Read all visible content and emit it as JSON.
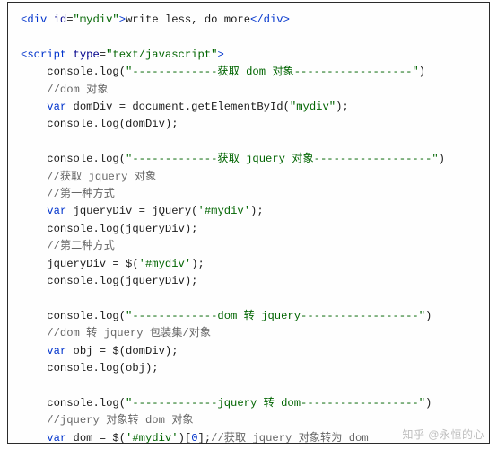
{
  "code": {
    "lines": [
      {
        "indent": 0,
        "spans": [
          {
            "t": "<div ",
            "c": "blue"
          },
          {
            "t": "id",
            "c": "dblue"
          },
          {
            "t": "=",
            "c": "black"
          },
          {
            "t": "\"mydiv\"",
            "c": "green"
          },
          {
            "t": ">",
            "c": "blue"
          },
          {
            "t": "write less, do more",
            "c": "black"
          },
          {
            "t": "</div>",
            "c": "blue"
          }
        ]
      },
      {
        "indent": 0,
        "spans": [
          {
            "t": " ",
            "c": "black"
          }
        ]
      },
      {
        "indent": 0,
        "spans": [
          {
            "t": "<script ",
            "c": "blue"
          },
          {
            "t": "type",
            "c": "dblue"
          },
          {
            "t": "=",
            "c": "black"
          },
          {
            "t": "\"text/javascript\"",
            "c": "green"
          },
          {
            "t": ">",
            "c": "blue"
          }
        ]
      },
      {
        "indent": 1,
        "spans": [
          {
            "t": "console.log(",
            "c": "black"
          },
          {
            "t": "\"-------------获取 dom 对象------------------\"",
            "c": "green"
          },
          {
            "t": ")",
            "c": "black"
          }
        ]
      },
      {
        "indent": 1,
        "spans": [
          {
            "t": "//dom 对象",
            "c": "gray"
          }
        ]
      },
      {
        "indent": 1,
        "spans": [
          {
            "t": "var ",
            "c": "blue"
          },
          {
            "t": "domDiv = document.getElementById(",
            "c": "black"
          },
          {
            "t": "\"mydiv\"",
            "c": "green"
          },
          {
            "t": ");",
            "c": "black"
          }
        ]
      },
      {
        "indent": 1,
        "spans": [
          {
            "t": "console.log(domDiv);",
            "c": "black"
          }
        ]
      },
      {
        "indent": 0,
        "spans": [
          {
            "t": " ",
            "c": "black"
          }
        ]
      },
      {
        "indent": 1,
        "spans": [
          {
            "t": "console.log(",
            "c": "black"
          },
          {
            "t": "\"-------------获取 jquery 对象------------------\"",
            "c": "green"
          },
          {
            "t": ")",
            "c": "black"
          }
        ]
      },
      {
        "indent": 1,
        "spans": [
          {
            "t": "//获取 jquery 对象",
            "c": "gray"
          }
        ]
      },
      {
        "indent": 1,
        "spans": [
          {
            "t": "//第一种方式",
            "c": "gray"
          }
        ]
      },
      {
        "indent": 1,
        "spans": [
          {
            "t": "var ",
            "c": "blue"
          },
          {
            "t": "jqueryDiv = jQuery(",
            "c": "black"
          },
          {
            "t": "'#mydiv'",
            "c": "green"
          },
          {
            "t": ");",
            "c": "black"
          }
        ]
      },
      {
        "indent": 1,
        "spans": [
          {
            "t": "console.log(jqueryDiv);",
            "c": "black"
          }
        ]
      },
      {
        "indent": 1,
        "spans": [
          {
            "t": "//第二种方式",
            "c": "gray"
          }
        ]
      },
      {
        "indent": 1,
        "spans": [
          {
            "t": "jqueryDiv = $(",
            "c": "black"
          },
          {
            "t": "'#mydiv'",
            "c": "green"
          },
          {
            "t": ");",
            "c": "black"
          }
        ]
      },
      {
        "indent": 1,
        "spans": [
          {
            "t": "console.log(jqueryDiv);",
            "c": "black"
          }
        ]
      },
      {
        "indent": 0,
        "spans": [
          {
            "t": " ",
            "c": "black"
          }
        ]
      },
      {
        "indent": 1,
        "spans": [
          {
            "t": "console.log(",
            "c": "black"
          },
          {
            "t": "\"-------------dom 转 jquery------------------\"",
            "c": "green"
          },
          {
            "t": ")",
            "c": "black"
          }
        ]
      },
      {
        "indent": 1,
        "spans": [
          {
            "t": "//dom 转 jquery 包装集/对象",
            "c": "gray"
          }
        ]
      },
      {
        "indent": 1,
        "spans": [
          {
            "t": "var ",
            "c": "blue"
          },
          {
            "t": "obj = $(domDiv);",
            "c": "black"
          }
        ]
      },
      {
        "indent": 1,
        "spans": [
          {
            "t": "console.log(obj);",
            "c": "black"
          }
        ]
      },
      {
        "indent": 0,
        "spans": [
          {
            "t": " ",
            "c": "black"
          }
        ]
      },
      {
        "indent": 1,
        "spans": [
          {
            "t": "console.log(",
            "c": "black"
          },
          {
            "t": "\"-------------jquery 转 dom------------------\"",
            "c": "green"
          },
          {
            "t": ")",
            "c": "black"
          }
        ]
      },
      {
        "indent": 1,
        "spans": [
          {
            "t": "//jquery 对象转 dom 对象",
            "c": "gray"
          }
        ]
      },
      {
        "indent": 1,
        "spans": [
          {
            "t": "var ",
            "c": "blue"
          },
          {
            "t": "dom = $(",
            "c": "black"
          },
          {
            "t": "'#mydiv'",
            "c": "green"
          },
          {
            "t": ")[",
            "c": "black"
          },
          {
            "t": "0",
            "c": "blue"
          },
          {
            "t": "];",
            "c": "black"
          },
          {
            "t": "//获取 jquery 对象转为 dom",
            "c": "gray"
          }
        ]
      }
    ]
  },
  "watermark": "知乎 @永恒的心"
}
